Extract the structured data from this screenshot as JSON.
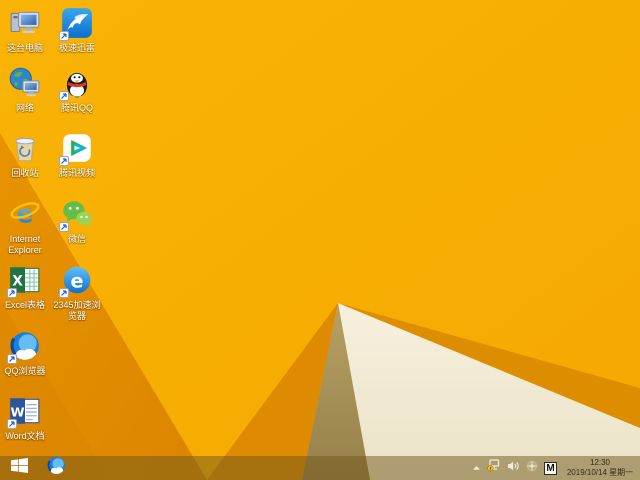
{
  "wallpaper": {
    "base_color": "#F8AF00",
    "dark_facet_color": "#E08B00",
    "shadow_facet_color": "#AF9A5F",
    "light_facet_color": "#F5EFDC",
    "taskbar_tint": "rgba(112,88,28,0.5)"
  },
  "desktop": {
    "icons": [
      {
        "id": "this-pc",
        "label": "这台电脑",
        "icon": "this-pc-icon",
        "shortcut": false
      },
      {
        "id": "xunlei-speed",
        "label": "极速迅雷",
        "icon": "xunlei-bird-icon",
        "shortcut": true
      },
      {
        "id": "network",
        "label": "网络",
        "icon": "network-globe-icon",
        "shortcut": false
      },
      {
        "id": "tencent-qq",
        "label": "腾讯QQ",
        "icon": "qq-penguin-icon",
        "shortcut": true
      },
      {
        "id": "recycle-bin",
        "label": "回收站",
        "icon": "recycle-bin-icon",
        "shortcut": false
      },
      {
        "id": "tencent-video",
        "label": "腾讯视频",
        "icon": "tencent-video-icon",
        "shortcut": true
      },
      {
        "id": "internet-explorer",
        "label": "Internet Explorer",
        "icon": "ie-icon",
        "shortcut": false
      },
      {
        "id": "wechat",
        "label": "微信",
        "icon": "wechat-icon",
        "shortcut": true
      },
      {
        "id": "excel",
        "label": "Excel表格",
        "icon": "excel-icon",
        "shortcut": true
      },
      {
        "id": "2345-browser",
        "label": "2345加速浏览器",
        "icon": "2345-browser-icon",
        "shortcut": true
      },
      {
        "id": "qq-browser",
        "label": "QQ浏览器",
        "icon": "qq-browser-icon",
        "shortcut": true
      },
      {
        "id": "word",
        "label": "Word文档",
        "icon": "word-icon",
        "shortcut": true
      }
    ]
  },
  "taskbar": {
    "pinned": [
      {
        "id": "qq-browser",
        "icon": "qq-browser-icon"
      }
    ],
    "tray": {
      "icons": [
        "hidden-icons-chevron",
        "network-warning-icon",
        "volume-icon",
        "tray-app-icon",
        "input-method-indicator"
      ],
      "input_method_label": "M"
    },
    "clock": {
      "time": "12:30",
      "date": "2019/10/14 星期一"
    }
  }
}
